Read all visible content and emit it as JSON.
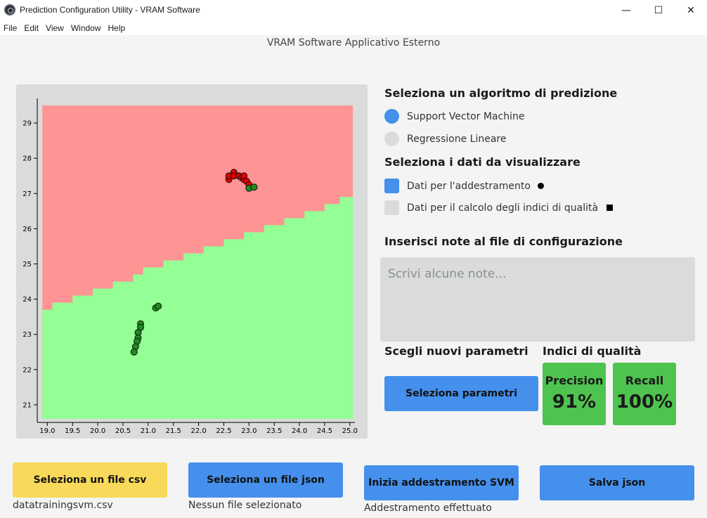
{
  "window": {
    "title": "Prediction Configuration Utility - VRAM Software",
    "minimize": "—",
    "maximize": "☐",
    "close": "✕"
  },
  "menu": [
    "File",
    "Edit",
    "View",
    "Window",
    "Help"
  ],
  "subtitle": "VRAM Software Applicativo Esterno",
  "algorithm": {
    "heading": "Seleziona un algoritmo di predizione",
    "options": [
      {
        "label": "Support Vector Machine",
        "selected": true
      },
      {
        "label": "Regressione Lineare",
        "selected": false
      }
    ]
  },
  "data_view": {
    "heading": "Seleziona i dati da visualizzare",
    "options": [
      {
        "label": "Dati per l'addestramento",
        "checked": true,
        "marker": "circle"
      },
      {
        "label": "Dati per il calcolo degli indici di qualità",
        "checked": false,
        "marker": "square"
      }
    ]
  },
  "notes": {
    "heading": "Inserisci note al file di configurazione",
    "placeholder": "Scrivi alcune note..."
  },
  "params": {
    "heading": "Scegli nuovi parametri",
    "button": "Seleziona parametri"
  },
  "quality": {
    "heading": "Indici di qualità",
    "precision_label": "Precision",
    "precision_value": "91%",
    "recall_label": "Recall",
    "recall_value": "100%"
  },
  "actions": {
    "csv_button": "Seleziona un file csv",
    "csv_status": "datatrainingsvm.csv",
    "json_button": "Seleziona un file json",
    "json_status": "Nessun file selezionato",
    "train_button": "Inizia addestramento SVM",
    "train_status": "Addestramento effettuato",
    "save_button": "Salva json"
  },
  "colors": {
    "accent_blue": "#4490ec",
    "yellow": "#f8d959",
    "metric_green": "#4ec34f",
    "region_red": "#ff9494",
    "region_green": "#94ff94",
    "point_red": "#e00000",
    "point_green": "#1f8a1f"
  },
  "chart_data": {
    "type": "scatter",
    "xlim": [
      18.8,
      25.1
    ],
    "ylim": [
      20.5,
      29.7
    ],
    "xticks": [
      19.0,
      19.5,
      20.0,
      20.5,
      21.0,
      21.5,
      22.0,
      22.5,
      23.0,
      23.5,
      24.0,
      24.5,
      25.0
    ],
    "yticks": [
      21,
      22,
      23,
      24,
      25,
      26,
      27,
      28,
      29
    ],
    "region_extent": {
      "x": [
        18.9,
        25.06
      ],
      "y": [
        20.6,
        29.5
      ]
    },
    "boundary": [
      [
        18.9,
        23.7
      ],
      [
        19.1,
        23.9
      ],
      [
        19.5,
        24.1
      ],
      [
        19.9,
        24.3
      ],
      [
        20.3,
        24.5
      ],
      [
        20.7,
        24.7
      ],
      [
        20.9,
        24.9
      ],
      [
        21.3,
        25.1
      ],
      [
        21.7,
        25.3
      ],
      [
        22.1,
        25.5
      ],
      [
        22.5,
        25.7
      ],
      [
        22.9,
        25.9
      ],
      [
        23.3,
        26.1
      ],
      [
        23.7,
        26.3
      ],
      [
        24.1,
        26.5
      ],
      [
        24.5,
        26.7
      ],
      [
        24.8,
        26.9
      ],
      [
        25.06,
        27.1
      ]
    ],
    "series": [
      {
        "color": "red",
        "points": [
          [
            22.6,
            27.4
          ],
          [
            22.6,
            27.5
          ],
          [
            22.7,
            27.6
          ],
          [
            22.7,
            27.5
          ],
          [
            22.8,
            27.5
          ],
          [
            22.85,
            27.45
          ],
          [
            22.9,
            27.4
          ],
          [
            22.9,
            27.5
          ],
          [
            22.95,
            27.35
          ],
          [
            23.0,
            27.25
          ]
        ]
      },
      {
        "color": "green",
        "points": [
          [
            23.0,
            27.15
          ],
          [
            23.1,
            27.18
          ],
          [
            21.15,
            23.75
          ],
          [
            21.2,
            23.8
          ],
          [
            20.85,
            23.3
          ],
          [
            20.85,
            23.2
          ],
          [
            20.8,
            23.05
          ],
          [
            20.8,
            22.9
          ],
          [
            20.78,
            22.8
          ],
          [
            20.75,
            22.65
          ],
          [
            20.72,
            22.5
          ]
        ]
      }
    ]
  }
}
